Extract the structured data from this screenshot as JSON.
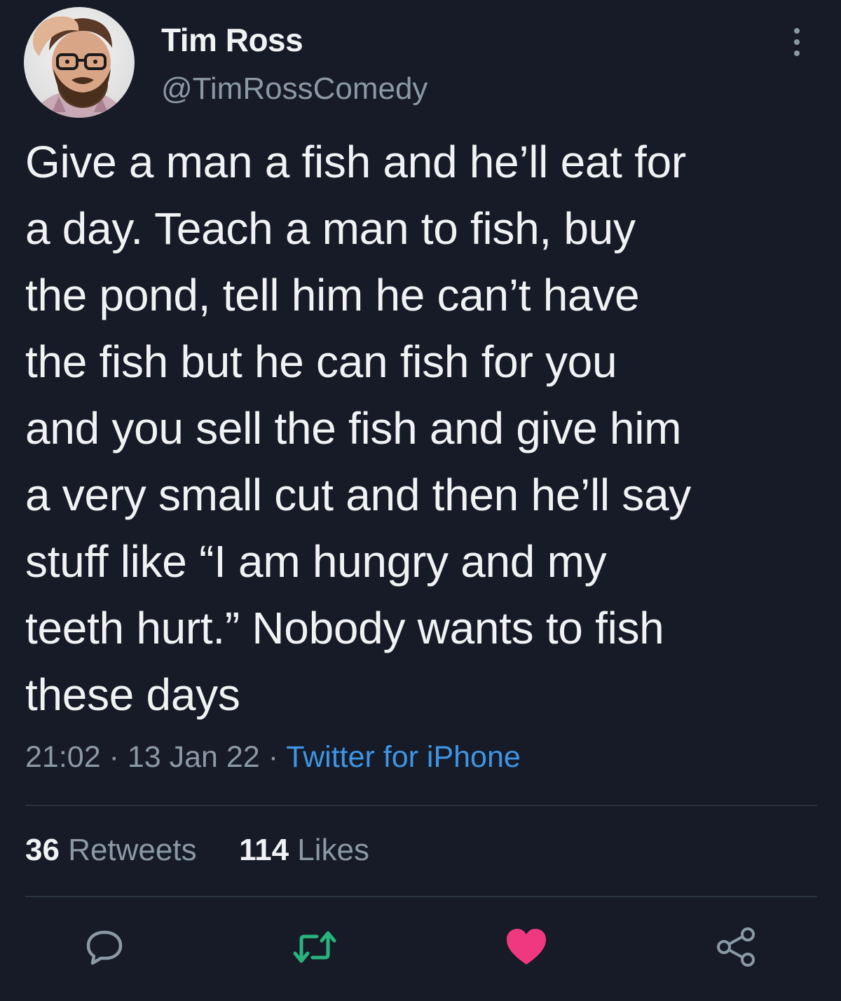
{
  "author": {
    "name": "Tim Ross",
    "handle": "@TimRossComedy"
  },
  "tweet": {
    "lines": [
      "Give a man a fish and he’ll eat for",
      "a day. Teach a man to fish, buy",
      "the pond, tell him he can’t have",
      "the fish but he can fish for you",
      "and you sell the fish and give him",
      "a very small cut and then he’ll say",
      "stuff like “I am hungry and my",
      "teeth hurt.” Nobody wants to fish",
      "these days"
    ],
    "time": "21:02",
    "separator": "·",
    "date": "13 Jan 22",
    "source": "Twitter for iPhone"
  },
  "stats": {
    "retweets_count": "36",
    "retweets_label": "Retweets",
    "likes_count": "114",
    "likes_label": "Likes"
  },
  "actions": {
    "reply_icon": "reply-icon",
    "retweet_icon": "retweet-icon",
    "like_icon": "heart-icon",
    "share_icon": "share-icon",
    "retweet_color": "#28b47c",
    "like_color": "#f0387e",
    "icon_color": "#8b98a5"
  }
}
